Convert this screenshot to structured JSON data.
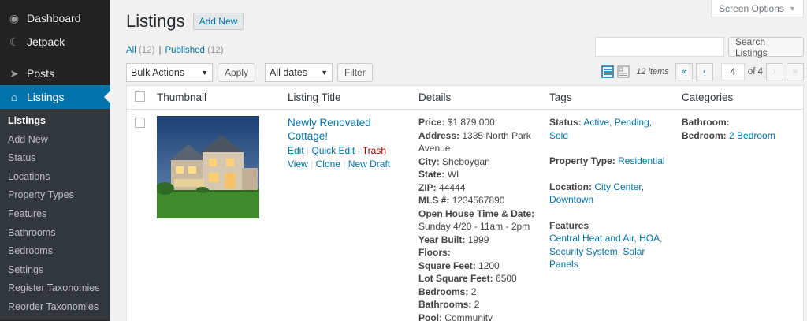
{
  "sidebar": {
    "top": [
      {
        "label": "Dashboard",
        "icon": "dashboard-icon"
      },
      {
        "label": "Jetpack",
        "icon": "jetpack-icon"
      },
      {
        "label": "Posts",
        "icon": "pin-icon"
      },
      {
        "label": "Listings",
        "icon": "home-icon"
      }
    ],
    "submenu": [
      "Listings",
      "Add New",
      "Status",
      "Locations",
      "Property Types",
      "Features",
      "Bathrooms",
      "Bedrooms",
      "Settings",
      "Register Taxonomies",
      "Reorder Taxonomies"
    ]
  },
  "header": {
    "title": "Listings",
    "add_new": "Add New",
    "screen_options": "Screen Options"
  },
  "views": {
    "all": "All",
    "all_count": "(12)",
    "separator": "|",
    "published": "Published",
    "published_count": "(12)"
  },
  "search": {
    "button": "Search Listings",
    "value": ""
  },
  "tablenav": {
    "bulk_actions": "Bulk Actions",
    "apply": "Apply",
    "dates": "All dates",
    "filter": "Filter",
    "items": "12 items",
    "first": "«",
    "prev": "‹",
    "page": "4",
    "of_pages": "of 4",
    "next": "›",
    "last": "»"
  },
  "table": {
    "headers": [
      "Thumbnail",
      "Listing Title",
      "Details",
      "Tags",
      "Categories"
    ],
    "row": {
      "title_line1": "Newly Renovated",
      "title_line2": "Cottage!",
      "actions": {
        "edit": "Edit",
        "quick_edit": "Quick Edit",
        "trash": "Trash",
        "view": "View",
        "clone": "Clone",
        "new_draft": "New Draft",
        "sep": "|"
      },
      "details": [
        {
          "label": "Price:",
          "value": "$1,879,000"
        },
        {
          "label": "Address:",
          "value": "1335 North Park Avenue"
        },
        {
          "label": "City:",
          "value": "Sheboygan"
        },
        {
          "label": "State:",
          "value": "WI"
        },
        {
          "label": "ZIP:",
          "value": "44444"
        },
        {
          "label": "MLS #:",
          "value": "1234567890"
        },
        {
          "label": "Open House Time & Date:",
          "value": "Sunday 4/20 - 11am - 2pm"
        },
        {
          "label": "Year Built:",
          "value": "1999"
        },
        {
          "label": "Floors:",
          "value": ""
        },
        {
          "label": "Square Feet:",
          "value": "1200"
        },
        {
          "label": "Lot Square Feet:",
          "value": "6500"
        },
        {
          "label": "Bedrooms:",
          "value": "2"
        },
        {
          "label": "Bathrooms:",
          "value": "2"
        },
        {
          "label": "Pool:",
          "value": "Community"
        }
      ],
      "tags": {
        "status_label": "Status:",
        "status": [
          "Active",
          "Pending",
          "Sold"
        ],
        "type_label": "Property Type:",
        "type": "Residential",
        "location_label": "Location:",
        "location": [
          "City Center",
          "Downtown"
        ],
        "features_label": "Features",
        "features": [
          "Central Heat and Air",
          "HOA",
          "Security System",
          "Solar Panels"
        ],
        "comma": ","
      },
      "categories": {
        "bathroom_label": "Bathroom:",
        "bedroom_label": "Bedroom:",
        "bedroom_value": "2 Bedroom"
      }
    }
  },
  "colors": {
    "accent": "#0073aa",
    "sidebar": "#222222",
    "trash": "#aa0000"
  }
}
